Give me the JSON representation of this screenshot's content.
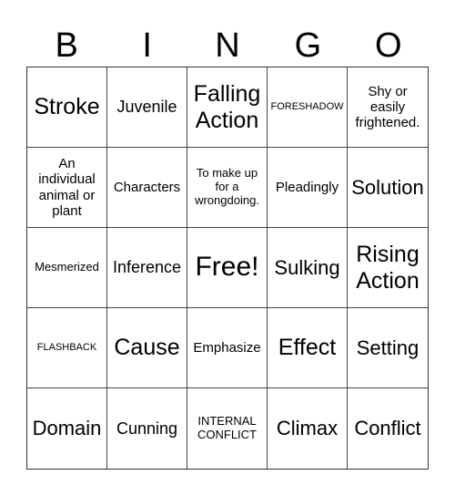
{
  "header": {
    "letters": [
      "B",
      "I",
      "N",
      "G",
      "O"
    ]
  },
  "board": {
    "cells": [
      "Stroke",
      "Juvenile",
      "Falling Action",
      "FORESHADOW",
      "Shy or easily frightened.",
      "An individual animal or plant",
      "Characters",
      "To make up for a wrongdoing.",
      "Pleadingly",
      "Solution",
      "Mesmerized",
      "Inference",
      "Free!",
      "Sulking",
      "Rising Action",
      "FLASHBACK",
      "Cause",
      "Emphasize",
      "Effect",
      "Setting",
      "Domain",
      "Cunning",
      "INTERNAL CONFLICT",
      "Climax",
      "Conflict"
    ]
  }
}
